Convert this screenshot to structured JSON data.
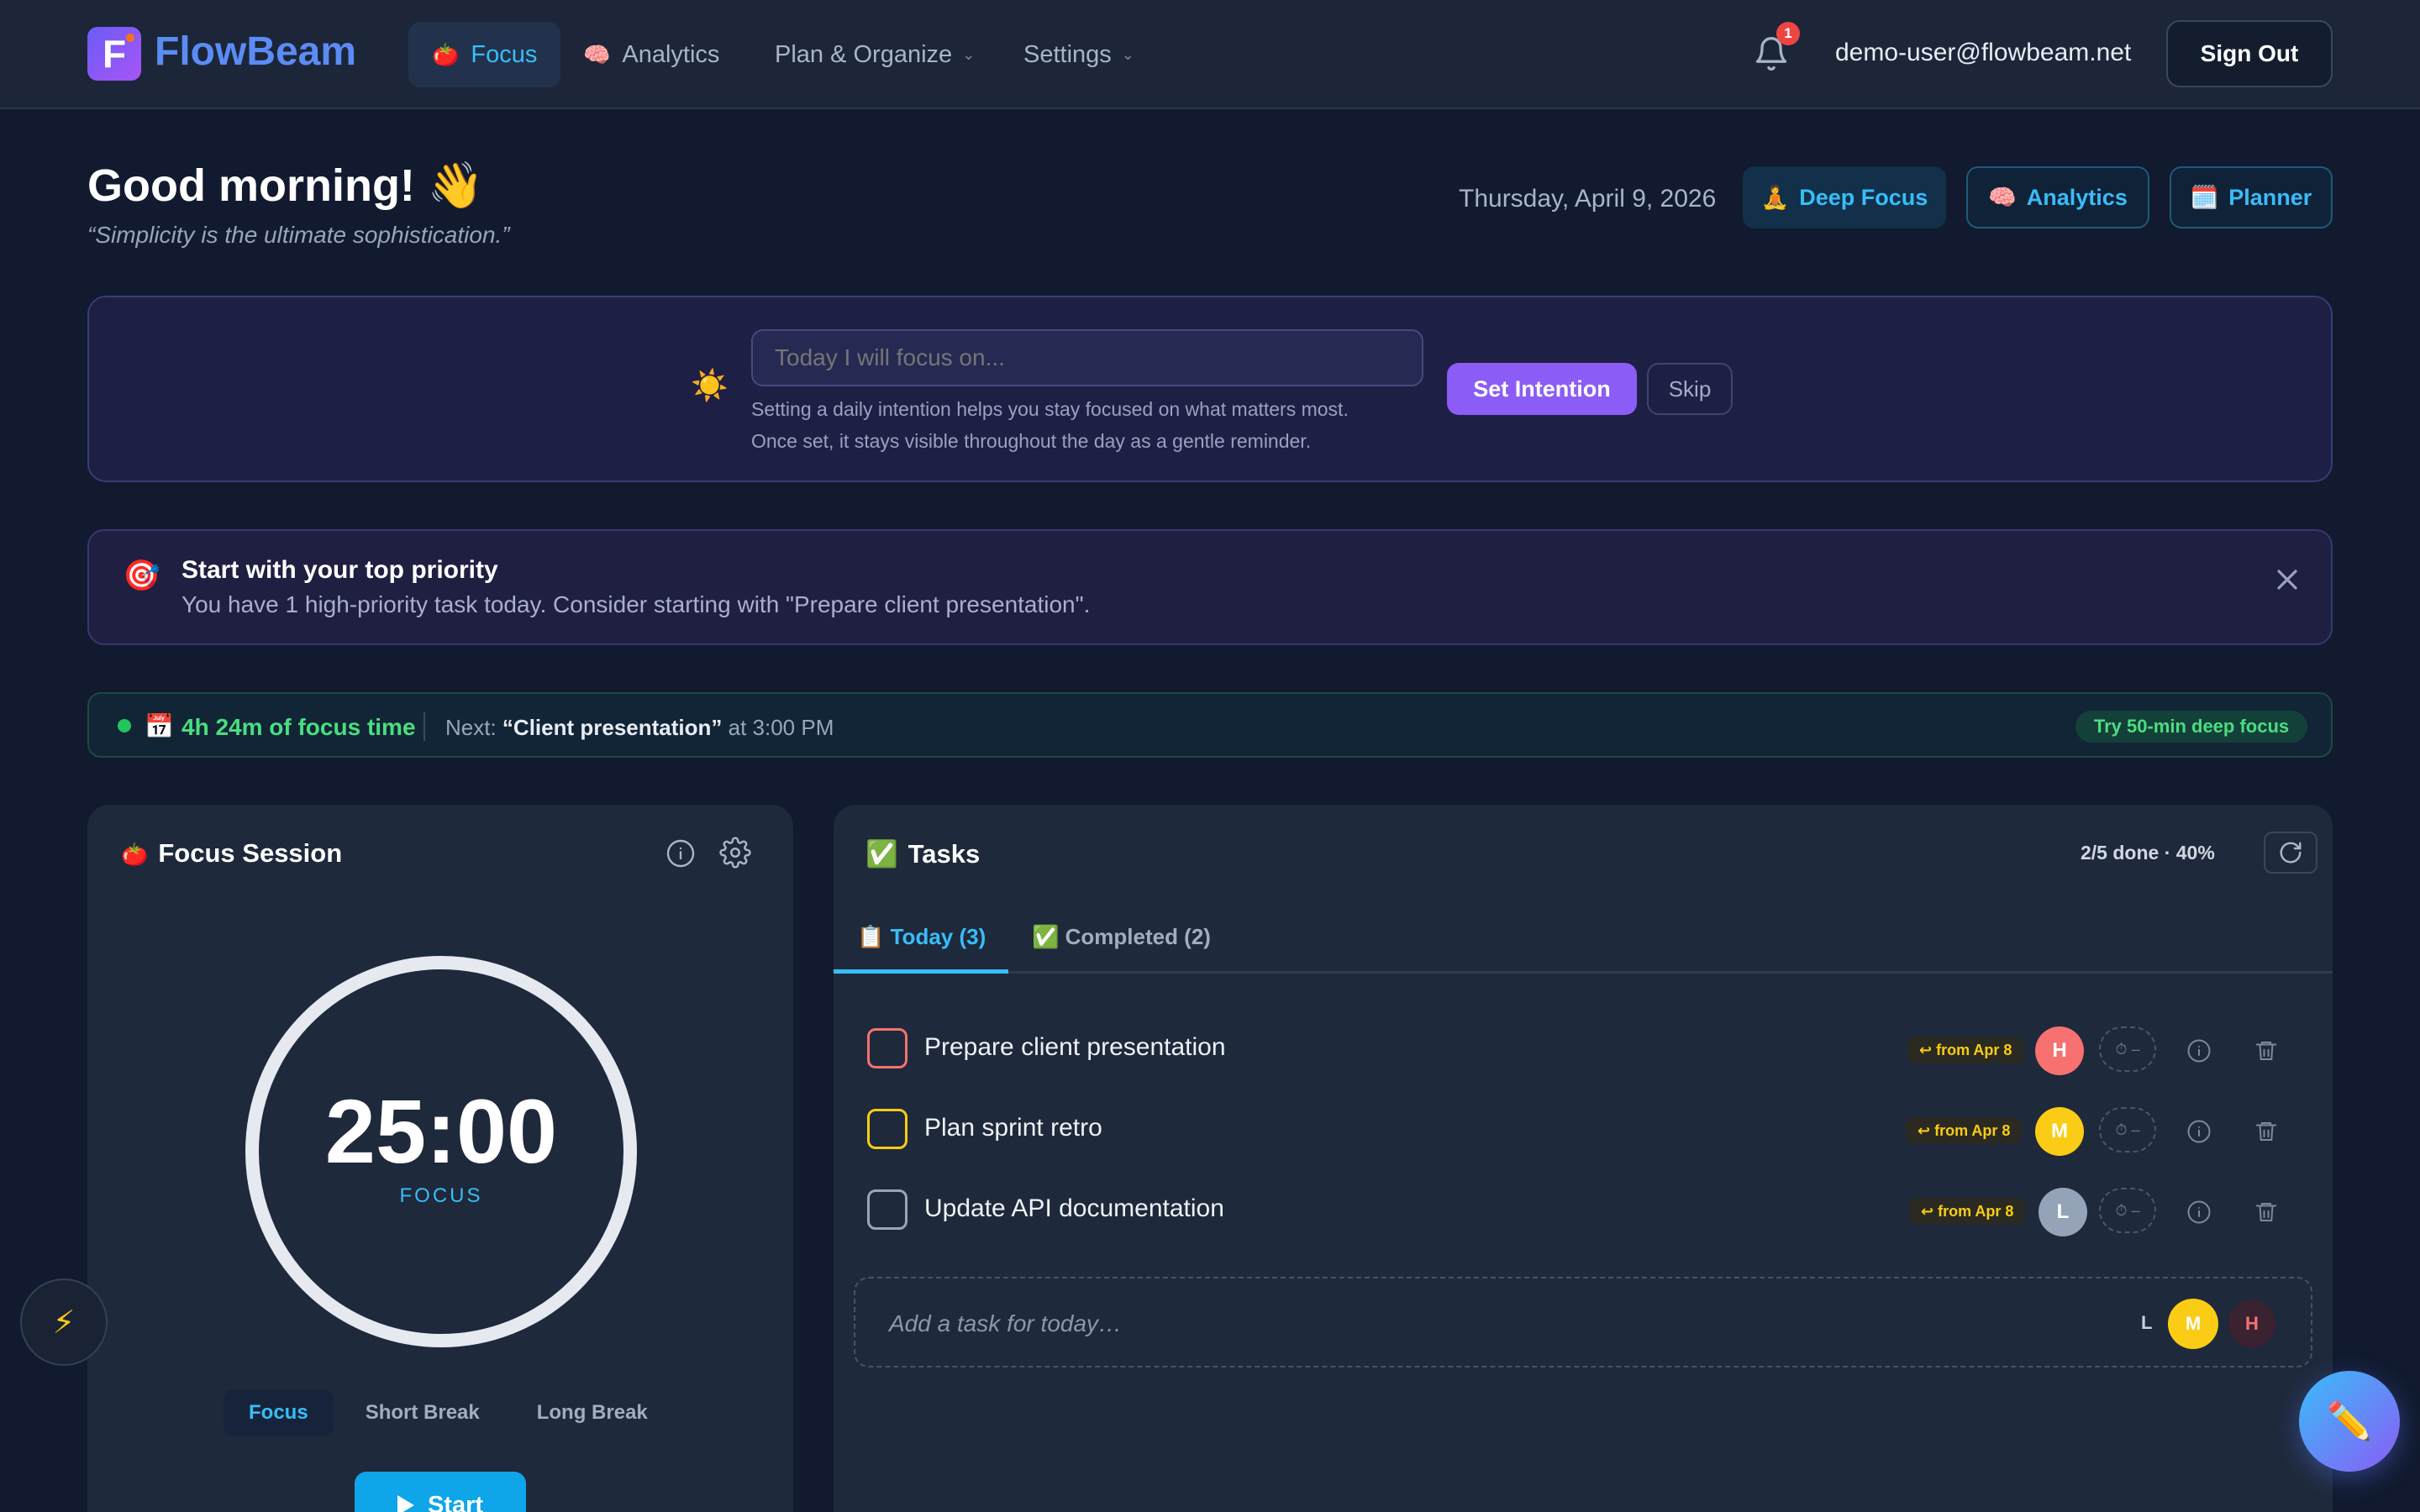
{
  "nav": {
    "brand": "FlowBeam",
    "items": [
      {
        "label": "Focus",
        "emoji": "🍅"
      },
      {
        "label": "Analytics",
        "emoji": "🧠"
      },
      {
        "label": "Plan & Organize"
      },
      {
        "label": "Settings"
      }
    ],
    "notifications": "1",
    "user_email": "demo-user@flowbeam.net",
    "sign_out": "Sign Out"
  },
  "header": {
    "greeting": "Good morning! 👋",
    "quote": "“Simplicity is the ultimate sophistication.”",
    "date": "Thursday, April 9, 2026",
    "quick_actions": [
      {
        "emoji": "🧘",
        "label": "Deep Focus"
      },
      {
        "emoji": "🧠",
        "label": "Analytics"
      },
      {
        "emoji": "🗓️",
        "label": "Planner"
      }
    ]
  },
  "intention": {
    "icon": "☀️",
    "placeholder": "Today I will focus on...",
    "help_line1": "Setting a daily intention helps you stay focused on what matters most.",
    "help_line2": "Once set, it stays visible throughout the day as a gentle reminder.",
    "set_label": "Set Intention",
    "skip_label": "Skip"
  },
  "priority": {
    "icon": "🎯",
    "title": "Start with your top priority",
    "text": "You have 1 high-priority task today. Consider starting with \"Prepare client presentation\"."
  },
  "strip": {
    "icon": "📅",
    "focus_time": "4h 24m of focus time",
    "next_prefix": "Next: ",
    "next_event": "“Client presentation”",
    "next_suffix": " at 3:00 PM",
    "try_label": "Try 50-min deep focus"
  },
  "focus_session": {
    "emoji": "🍅",
    "title": "Focus Session",
    "timer": "25:00",
    "mode_label": "FOCUS",
    "modes": [
      "Focus",
      "Short Break",
      "Long Break"
    ],
    "start_label": "Start"
  },
  "tasks": {
    "emoji": "✅",
    "title": "Tasks",
    "done_summary": "2/5 done · 40%",
    "tabs": [
      {
        "emoji": "📋",
        "label": "Today (3)"
      },
      {
        "emoji": "✅",
        "label": "Completed (2)"
      }
    ],
    "rows": [
      {
        "name": "Prepare client presentation",
        "from": "↩ from Apr 8",
        "priority": "H",
        "checkbox_color": "#f87171",
        "avatar_color": "#f87171",
        "timer": "⏱ –"
      },
      {
        "name": "Plan sprint retro",
        "from": "↩ from Apr 8",
        "priority": "M",
        "checkbox_color": "#facc15",
        "avatar_color": "#facc15",
        "timer": "⏱ –"
      },
      {
        "name": "Update API documentation",
        "from": "↩ from Apr 8",
        "priority": "L",
        "checkbox_color": "#9aa5bb",
        "avatar_color": "#94a3b8",
        "timer": "⏱ –"
      }
    ],
    "add_placeholder": "Add a task for today…",
    "priority_options": [
      "L",
      "M",
      "H"
    ]
  },
  "floating": {
    "left_icon": "⚡",
    "right_icon": "✏️"
  }
}
